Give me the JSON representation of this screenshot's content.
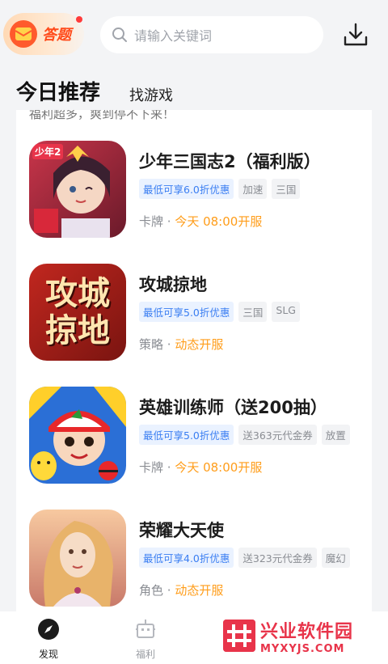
{
  "header": {
    "quiz_label": "答题",
    "search_placeholder": "请输入关键词"
  },
  "tabs": [
    {
      "label": "今日推荐",
      "active": true
    },
    {
      "label": "找游戏",
      "active": false
    }
  ],
  "partial_banner_text": "福利超多，爽到停不下来！",
  "games": [
    {
      "title": "少年三国志2（福利版）",
      "discount": "最低可享6.0折优惠",
      "tags": [
        "加速",
        "三国"
      ],
      "category": "卡牌",
      "separator": " · ",
      "open_time": "今天 08:00开服",
      "icon": "game-icon-shaonian-sanguozhi"
    },
    {
      "title": "攻城掠地",
      "discount": "最低可享5.0折优惠",
      "tags": [
        "三国",
        "SLG"
      ],
      "category": "策略",
      "separator": " · ",
      "open_time": "动态开服",
      "icon": "game-icon-gongcheng-ludi"
    },
    {
      "title": "英雄训练师（送200抽）",
      "discount": "最低可享5.0折优惠",
      "tags": [
        "送363元代金券",
        "放置"
      ],
      "category": "卡牌",
      "separator": " · ",
      "open_time": "今天 08:00开服",
      "icon": "game-icon-yingxiong-xunlianshi"
    },
    {
      "title": "荣耀大天使",
      "discount": "最低可享4.0折优惠",
      "tags": [
        "送323元代金券",
        "魔幻"
      ],
      "category": "角色",
      "separator": " · ",
      "open_time": "动态开服",
      "icon": "game-icon-rongyao-datianshi"
    }
  ],
  "icon_text": {
    "gongcheng_ludi": "攻城掠地",
    "shaonian_badge": "少年2"
  },
  "bottom_nav": [
    {
      "label": "发现",
      "icon": "compass-icon",
      "active": true
    },
    {
      "label": "福利",
      "icon": "gift-robot-icon",
      "active": false
    }
  ],
  "watermark": {
    "main": "兴业软件园",
    "sub": "MYXYJS.COM"
  },
  "colors": {
    "accent_blue": "#3a7ef2",
    "accent_orange": "#ff9d1a",
    "quiz_orange": "#ff4a1a",
    "watermark_red": "#e8344a"
  }
}
